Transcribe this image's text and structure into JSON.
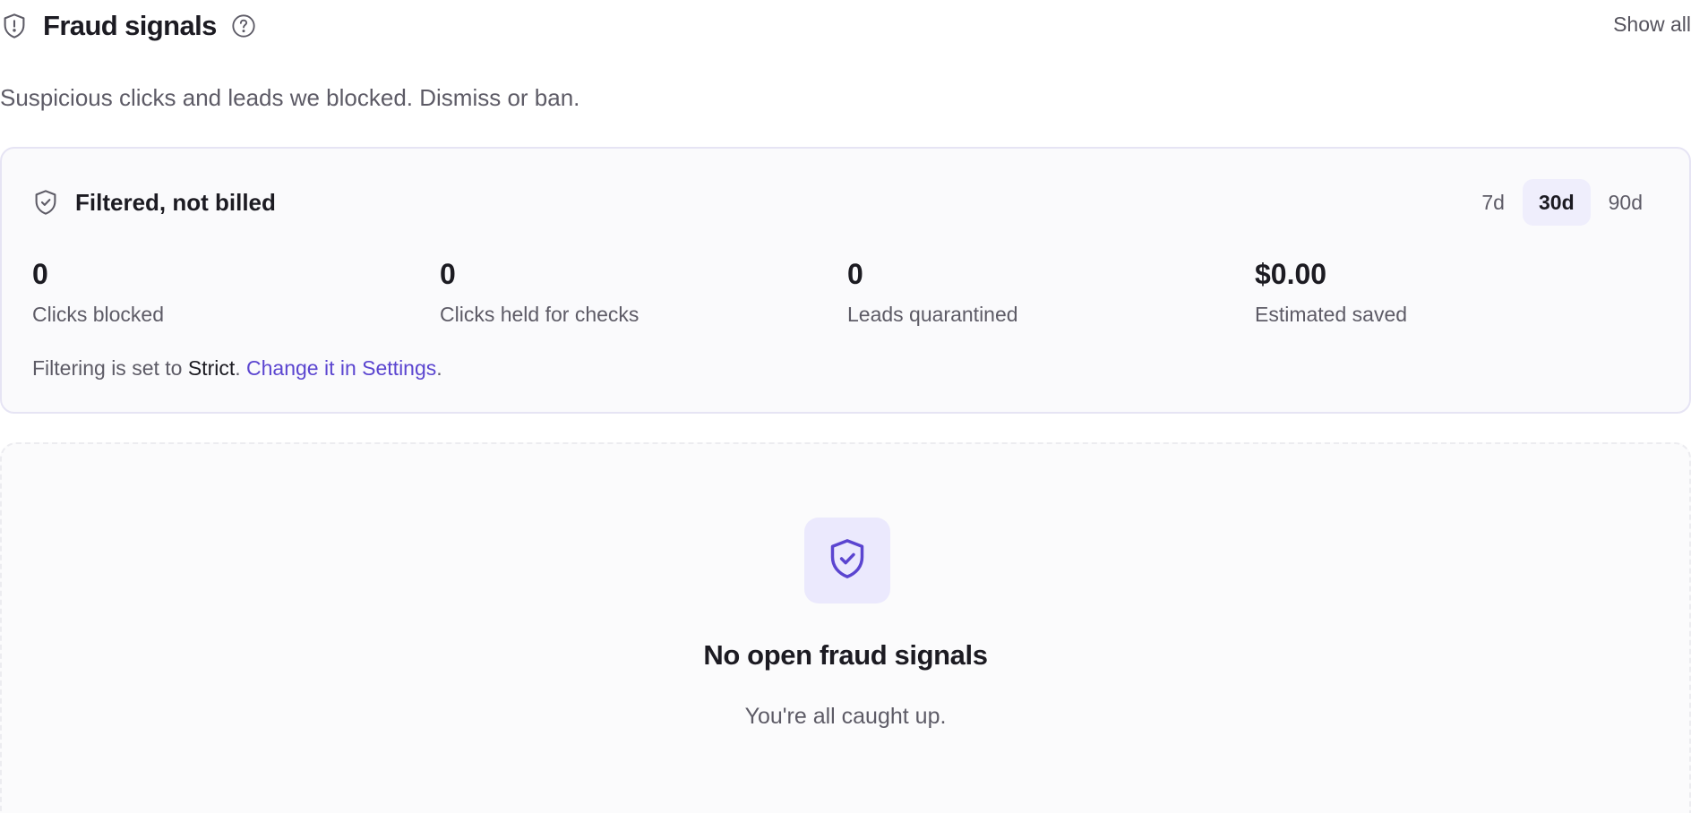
{
  "header": {
    "title": "Fraud signals",
    "title_icon": "shield-alert-icon",
    "help_icon": "help-circle-icon",
    "show_all": "Show all"
  },
  "subtitle": "Suspicious clicks and leads we blocked. Dismiss or ban.",
  "summary": {
    "icon": "shield-check-icon",
    "title": "Filtered, not billed",
    "ranges": [
      "7d",
      "30d",
      "90d"
    ],
    "active_range": "30d",
    "stats": [
      {
        "value": "0",
        "label": "Clicks blocked"
      },
      {
        "value": "0",
        "label": "Clicks held for checks"
      },
      {
        "value": "0",
        "label": "Leads quarantined"
      },
      {
        "value": "$0.00",
        "label": "Estimated saved"
      }
    ],
    "filter_prefix": "Filtering is set to ",
    "filter_level": "Strict",
    "filter_sep": ". ",
    "filter_link": "Change it in Settings",
    "filter_suffix": "."
  },
  "empty_state": {
    "icon": "shield-check-icon",
    "title": "No open fraud signals",
    "subtitle": "You're all caught up."
  },
  "colors": {
    "accent": "#5b45d0",
    "card_border": "#e6e4f4",
    "active_tab_bg": "#efeefc",
    "badge_bg": "#ebe9fd"
  }
}
